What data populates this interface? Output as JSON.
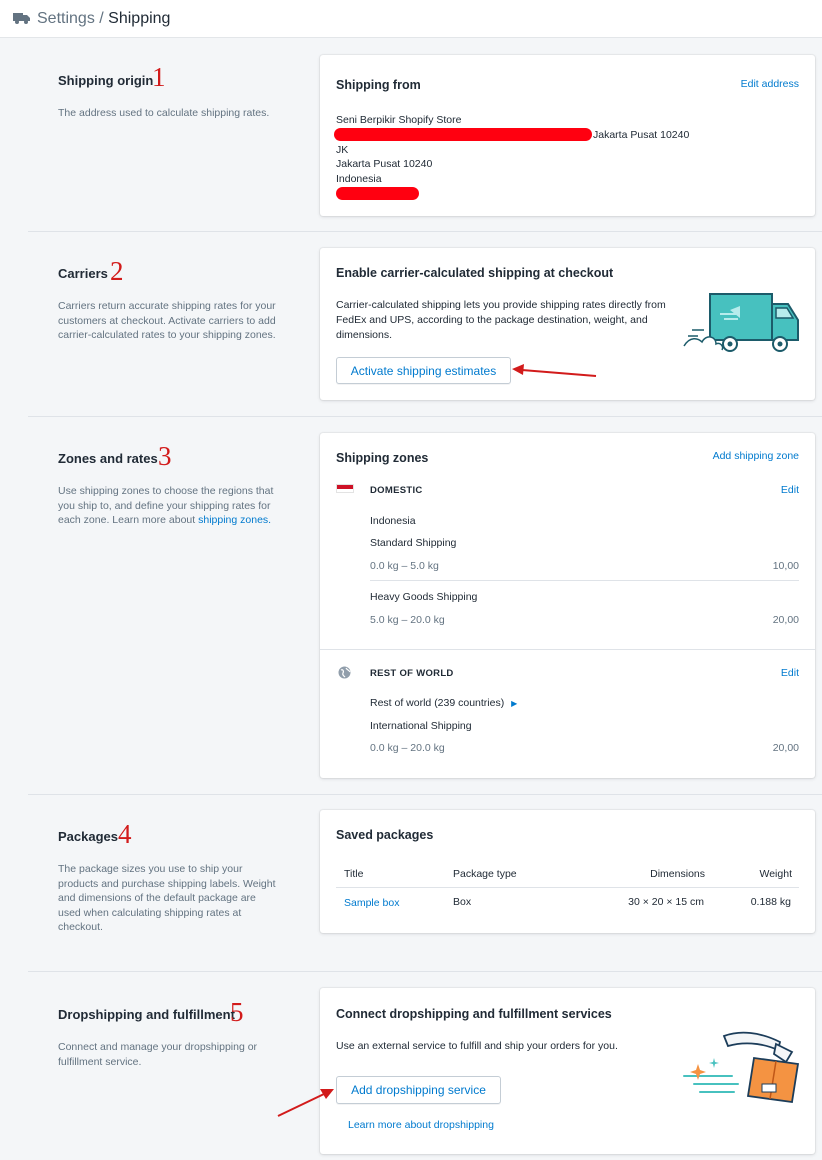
{
  "breadcrumb": {
    "parent": "Settings",
    "separator": "/",
    "current": "Shipping"
  },
  "sections": {
    "origin": {
      "title": "Shipping origin",
      "number": "1",
      "desc": "The address used to calculate shipping rates.",
      "card_title": "Shipping from",
      "edit_label": "Edit address",
      "address": {
        "store": "Seni Berpikir Shopify Store",
        "line1_suffix": "Jakarta Pusat 10240",
        "region": "JK",
        "city": "Jakarta Pusat 10240",
        "country": "Indonesia"
      }
    },
    "carriers": {
      "title": "Carriers",
      "number": "2",
      "desc": "Carriers return accurate shipping rates for your customers at checkout. Activate carriers to add carrier-calculated rates to your shipping zones.",
      "card_title": "Enable carrier-calculated shipping at checkout",
      "card_desc": "Carrier-calculated shipping lets you provide shipping rates directly from FedEx and UPS, according to the package destination, weight, and dimensions.",
      "button": "Activate shipping estimates"
    },
    "zones": {
      "title": "Zones and rates",
      "number": "3",
      "desc": "Use shipping zones to choose the regions that you ship to, and define your shipping rates for each zone. Learn more about",
      "desc_link": "shipping zones.",
      "card_title": "Shipping zones",
      "add_label": "Add shipping zone",
      "domestic": {
        "name": "DOMESTIC",
        "edit": "Edit",
        "country": "Indonesia",
        "rates": [
          {
            "name": "Standard Shipping",
            "range": "0.0 kg – 5.0 kg",
            "price": "10,00"
          },
          {
            "name": "Heavy Goods Shipping",
            "range": "5.0 kg – 20.0 kg",
            "price": "20,00"
          }
        ]
      },
      "rest": {
        "name": "REST OF WORLD",
        "edit": "Edit",
        "countries": "Rest of world (239 countries)",
        "rate": {
          "name": "International Shipping",
          "range": "0.0 kg – 20.0 kg",
          "price": "20,00"
        }
      }
    },
    "packages": {
      "title": "Packages",
      "number": "4",
      "desc": "The package sizes you use to ship your products and purchase shipping labels. Weight and dimensions of the default package are used when calculating shipping rates at checkout.",
      "card_title": "Saved packages",
      "columns": [
        "Title",
        "Package type",
        "Dimensions",
        "Weight"
      ],
      "rows": [
        {
          "title": "Sample box",
          "type": "Box",
          "dimensions": "30 × 20 × 15 cm",
          "weight": "0.188 kg"
        }
      ]
    },
    "dropship": {
      "title": "Dropshipping and fulfillment",
      "number": "5",
      "desc": "Connect and manage your dropshipping or fulfillment service.",
      "card_title": "Connect dropshipping and fulfillment services",
      "card_desc": "Use an external service to fulfill and ship your orders for you.",
      "button": "Add dropshipping service",
      "link": "Learn more about dropshipping"
    }
  },
  "colors": {
    "accent": "#007ace",
    "annotation": "#d21b1b",
    "redaction": "#ff0010",
    "truck": "#47c1bf"
  }
}
